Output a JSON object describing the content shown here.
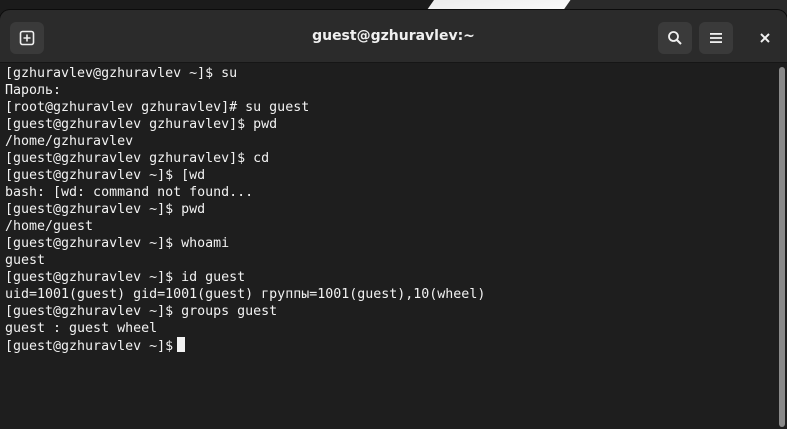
{
  "window": {
    "title": "guest@gzhuravlev:~"
  },
  "titlebar": {
    "new_tab_icon": "new-tab-icon",
    "search_icon": "search-icon",
    "menu_icon": "hamburger-menu-icon",
    "close_icon": "close-icon"
  },
  "terminal": {
    "lines": [
      "[gzhuravlev@gzhuravlev ~]$ su",
      "Пароль:",
      "[root@gzhuravlev gzhuravlev]# su guest",
      "[guest@gzhuravlev gzhuravlev]$ pwd",
      "/home/gzhuravlev",
      "[guest@gzhuravlev gzhuravlev]$ cd",
      "[guest@gzhuravlev ~]$ [wd",
      "bash: [wd: command not found...",
      "[guest@gzhuravlev ~]$ pwd",
      "/home/guest",
      "[guest@gzhuravlev ~]$ whoami",
      "guest",
      "[guest@gzhuravlev ~]$ id guest",
      "uid=1001(guest) gid=1001(guest) группы=1001(guest),10(wheel)",
      "[guest@gzhuravlev ~]$ groups guest",
      "guest : guest wheel"
    ],
    "prompt": "[guest@gzhuravlev ~]$"
  },
  "colors": {
    "background": "#1e1e1e",
    "titlebar": "#2b2b2b",
    "text": "#f2f2f2"
  }
}
